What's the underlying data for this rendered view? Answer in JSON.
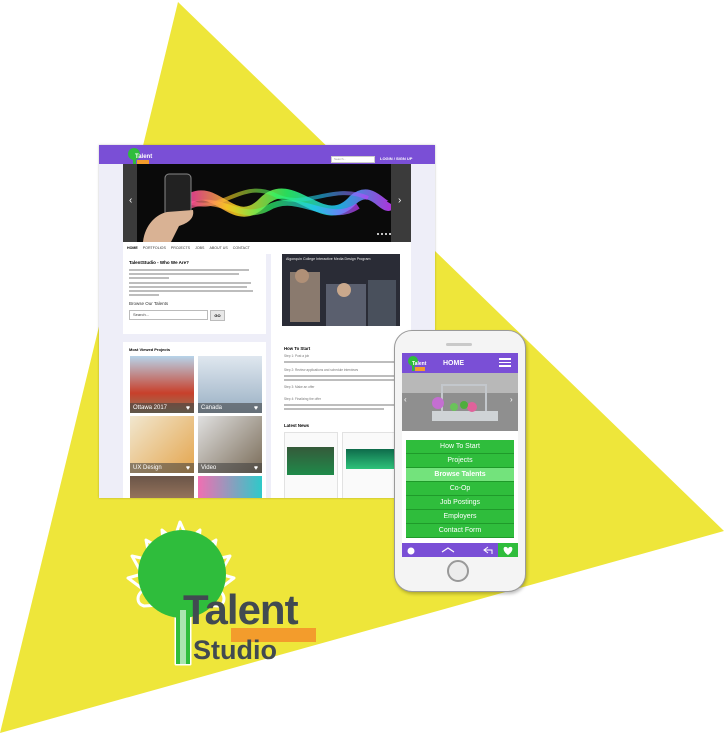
{
  "colors": {
    "triangle": "#eee63a",
    "purple": "#7a4fd6",
    "green": "#2fbd3c",
    "orange": "#f39c2c",
    "dark_text": "#414a51"
  },
  "desktop": {
    "logo_text": "Talent",
    "search_placeholder": "Search...",
    "login": "LOGIN / SIGN UP",
    "hero_prev": "‹",
    "hero_next": "›",
    "nav": [
      "HOME",
      "PORTFOLIOS",
      "PROJECTS",
      "JOBS",
      "ABOUT US",
      "CONTACT"
    ],
    "who_title": "TalentStudio - Who We Are?",
    "browse_label": "Browse Our Talents",
    "browse_search": "Search...",
    "go_button": "GO",
    "most_viewed_title": "Most Viewed Projects",
    "tiles": [
      "Ottawa 2017",
      "Canada",
      "UX Design",
      "Video"
    ],
    "video_title": "Algonquin College Interactive Media Design Program",
    "how_to_title": "How To Start",
    "steps": [
      "Step 1: Post a job",
      "Step 2: Review applications and schedule interviews",
      "Step 3: Make an offer",
      "Step 4: Finalizing the offer"
    ],
    "latest_news_title": "Latest News"
  },
  "phone": {
    "logo_text": "Talent",
    "header_title": "HOME",
    "menu": [
      "How To Start",
      "Projects",
      "Browse Talents",
      "Co-Op",
      "Job Postings",
      "Employers",
      "Contact Form"
    ],
    "active_index": 2
  },
  "brand": {
    "word1": "Talent",
    "word2": "Studio"
  }
}
